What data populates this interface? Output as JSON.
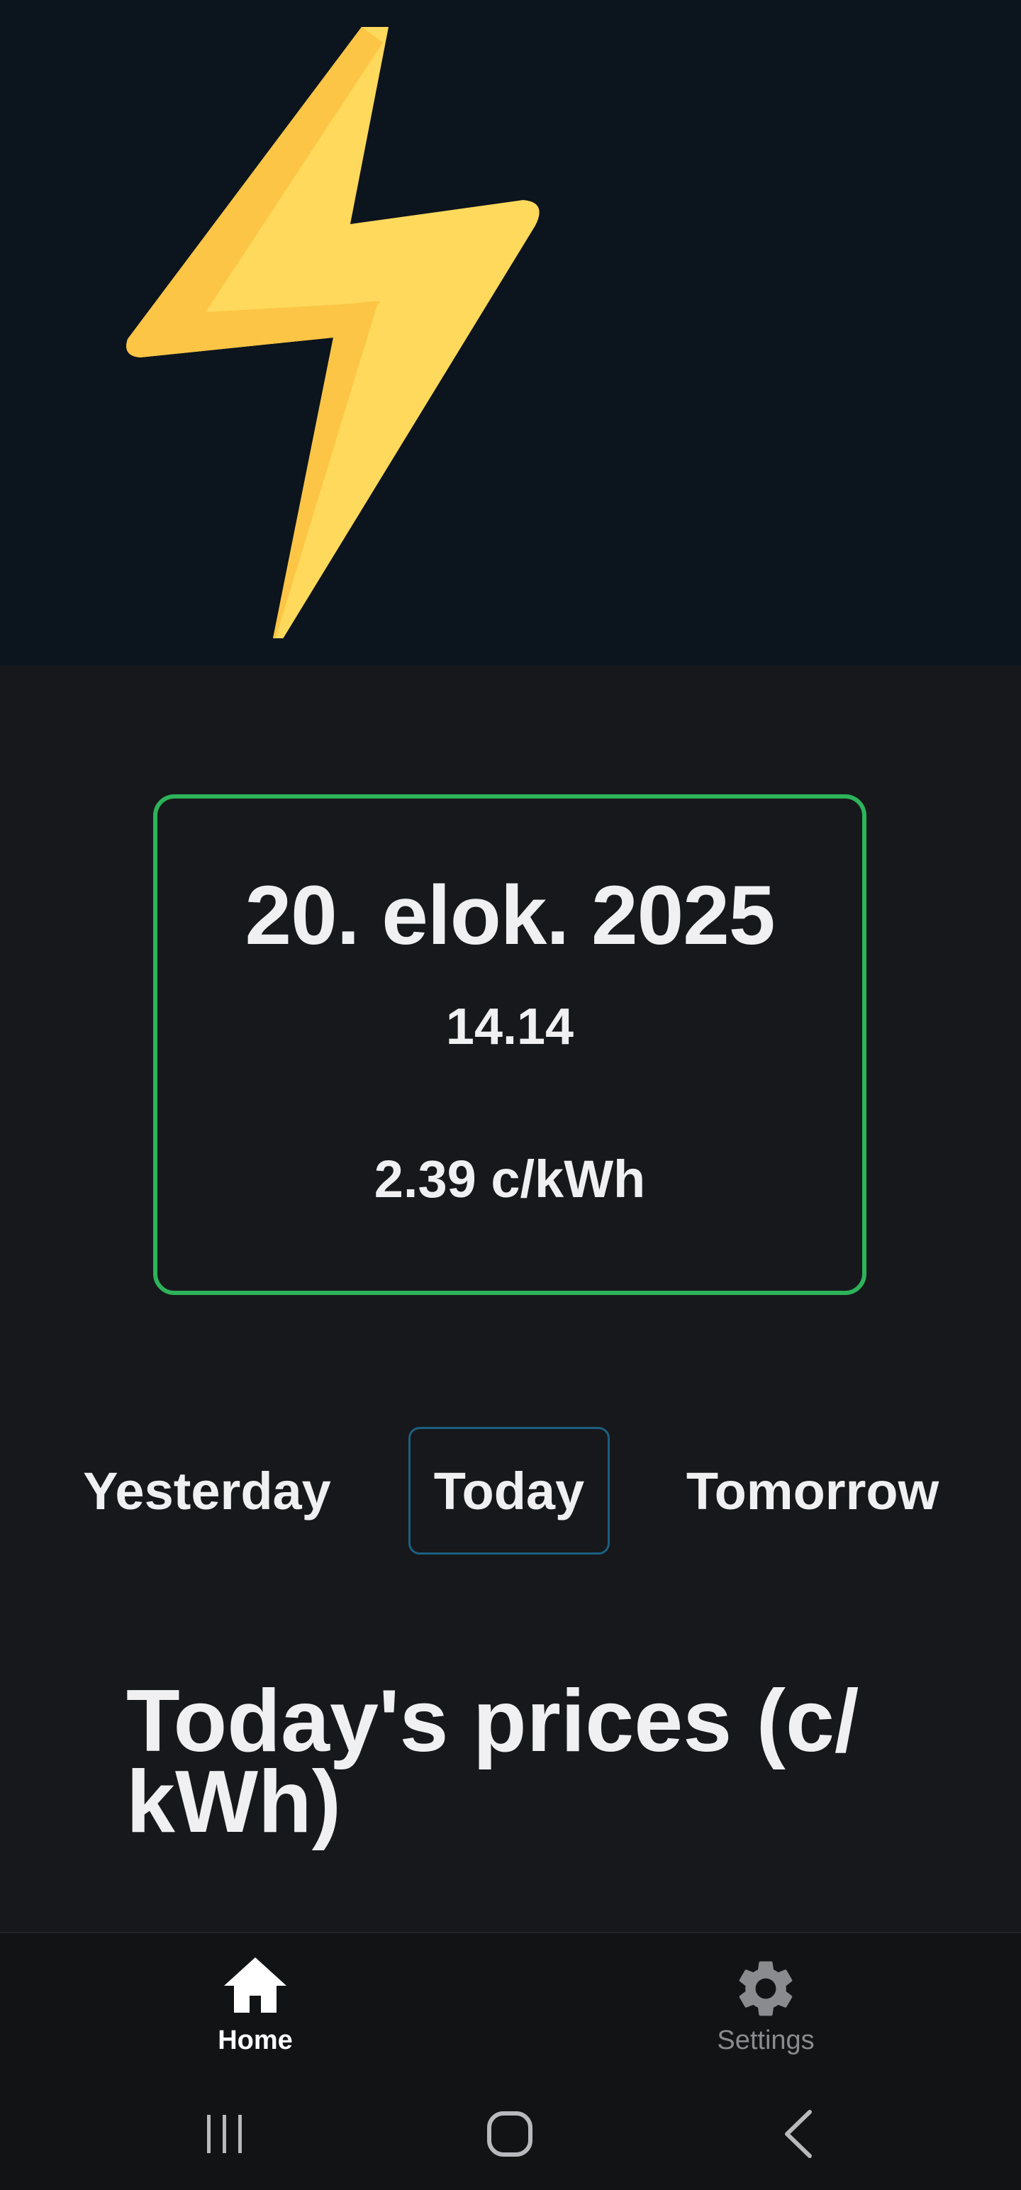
{
  "hero": {
    "icon": "lightning-bolt-icon"
  },
  "price_card": {
    "date": "20. elok. 2025",
    "time": "14.14",
    "price": "2.39 c/kWh",
    "border_color": "#2db35a"
  },
  "day_tabs": {
    "yesterday": "Yesterday",
    "today": "Today",
    "tomorrow": "Tomorrow",
    "selected": "today"
  },
  "section": {
    "heading": "Today's prices (c/ kWh)"
  },
  "bottom_nav": {
    "items": [
      {
        "label": "Home",
        "icon": "home-icon",
        "active": true
      },
      {
        "label": "Settings",
        "icon": "gear-icon",
        "active": false
      }
    ]
  },
  "system_nav": {
    "recents_icon": "recents-icon",
    "home_icon": "system-home-icon",
    "back_icon": "back-icon"
  },
  "colors": {
    "background": "#17181b",
    "hero_background": "#0c141d",
    "accent_green": "#2db35a",
    "selected_tab_border": "#1b5f80"
  }
}
